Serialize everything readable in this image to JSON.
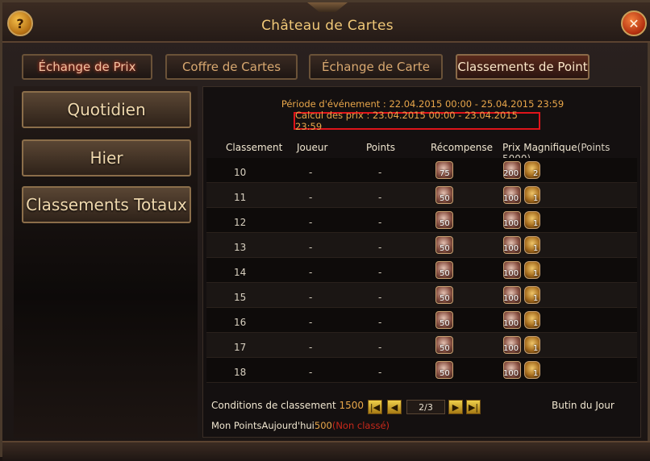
{
  "window": {
    "title": "Château de Cartes",
    "help_label": "?",
    "close_label": "✕"
  },
  "tabs": [
    {
      "label": "Échange de Prix"
    },
    {
      "label": "Coffre de Cartes"
    },
    {
      "label": "Échange de Carte"
    },
    {
      "label": "Classements de Point"
    }
  ],
  "sidebar": [
    {
      "label": "Quotidien"
    },
    {
      "label": "Hier"
    },
    {
      "label": "Classements Totaux"
    }
  ],
  "info": {
    "period": "Période d'événement : 22.04.2015 00:00 - 25.04.2015 23:59",
    "calc": "Calcul des prix : 23.04.2015 00:00 - 23.04.2015 23:59"
  },
  "table": {
    "headers": {
      "rank": "Classement",
      "player": "Joueur",
      "points": "Points",
      "reward": "Récompense",
      "grand_prize": "Prix Magnifique",
      "grand_prize_note": "(Points 5000)"
    },
    "rows": [
      {
        "rank": "10",
        "player": "-",
        "points": "-",
        "reward": "75",
        "gp1": "200",
        "gp2": "2"
      },
      {
        "rank": "11",
        "player": "-",
        "points": "-",
        "reward": "50",
        "gp1": "100",
        "gp2": "1"
      },
      {
        "rank": "12",
        "player": "-",
        "points": "-",
        "reward": "50",
        "gp1": "100",
        "gp2": "1"
      },
      {
        "rank": "13",
        "player": "-",
        "points": "-",
        "reward": "50",
        "gp1": "100",
        "gp2": "1"
      },
      {
        "rank": "14",
        "player": "-",
        "points": "-",
        "reward": "50",
        "gp1": "100",
        "gp2": "1"
      },
      {
        "rank": "15",
        "player": "-",
        "points": "-",
        "reward": "50",
        "gp1": "100",
        "gp2": "1"
      },
      {
        "rank": "16",
        "player": "-",
        "points": "-",
        "reward": "50",
        "gp1": "100",
        "gp2": "1"
      },
      {
        "rank": "17",
        "player": "-",
        "points": "-",
        "reward": "50",
        "gp1": "100",
        "gp2": "1"
      },
      {
        "rank": "18",
        "player": "-",
        "points": "-",
        "reward": "50",
        "gp1": "100",
        "gp2": "1"
      }
    ]
  },
  "footer": {
    "conditions_label": "Conditions de classement",
    "conditions_value": "1500",
    "my_points_label": "Mon PointsAujourd'hui",
    "my_points_value": "500",
    "my_points_status": "(Non classé)",
    "page": "2/3",
    "first_label": "|◀",
    "prev_label": "◀",
    "next_label": "▶",
    "last_label": "▶|",
    "butin_label": "Butin du Jour"
  }
}
